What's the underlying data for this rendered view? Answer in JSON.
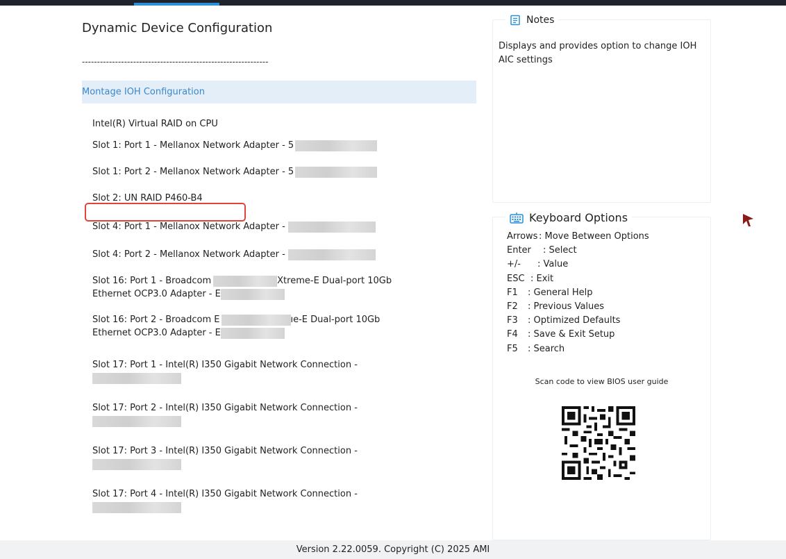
{
  "page": {
    "title": "Dynamic Device Configuration",
    "separator": "--------------------------------------------------------------"
  },
  "items": [
    {
      "lines": [
        "Montage IOH Configuration"
      ],
      "selected": true
    },
    {
      "lines": [
        "Intel(R) Virtual RAID on CPU"
      ]
    },
    {
      "lines": [
        "Slot 1: Port 1 - Mellanox Network Adapter - 5"
      ]
    },
    {
      "lines": [
        "Slot 1: Port 2 - Mellanox Network Adapter - 5"
      ]
    },
    {
      "lines": [
        "Slot 2: UN RAID P460-B4"
      ]
    },
    {
      "lines": [
        "Slot 4: Port 1 - Mellanox Network Adapter -"
      ]
    },
    {
      "lines": [
        "Slot 4: Port 2 - Mellanox Network Adapter -"
      ]
    },
    {
      "lines": [
        "Slot 16: Port 1 - Broadcom",
        "Ethernet OCP3.0 Adapter - E"
      ],
      "extra": "Xtreme-E Dual-port 10Gb"
    },
    {
      "lines": [
        "Slot 16: Port 2 - Broadcom E",
        "Ethernet OCP3.0 Adapter - E"
      ],
      "extra": "ıe-E Dual-port 10Gb"
    },
    {
      "lines": [
        "Slot 17: Port 1 - Intel(R) I350 Gigabit Network Connection -"
      ]
    },
    {
      "lines": [
        "Slot 17: Port 2 - Intel(R) I350 Gigabit Network Connection -"
      ]
    },
    {
      "lines": [
        "Slot 17: Port 3 - Intel(R) I350 Gigabit Network Connection -"
      ]
    },
    {
      "lines": [
        "Slot 17: Port 4 - Intel(R) I350 Gigabit Network Connection -"
      ]
    }
  ],
  "notes": {
    "title": "Notes",
    "text": "Displays and provides option to change IOH AIC settings"
  },
  "keyboard": {
    "title": "Keyboard Options",
    "options": [
      {
        "key": "Arrows",
        "desc": ": Move Between Options"
      },
      {
        "key": "Enter",
        "desc": ": Select"
      },
      {
        "key": "+/-",
        "desc": ": Value"
      },
      {
        "key": "ESC",
        "desc": ": Exit"
      },
      {
        "key": "F1",
        "desc": ": General Help"
      },
      {
        "key": "F2",
        "desc": ": Previous Values"
      },
      {
        "key": "F3",
        "desc": ": Optimized Defaults"
      },
      {
        "key": "F4",
        "desc": ": Save & Exit Setup"
      },
      {
        "key": "F5",
        "desc": ": Search"
      }
    ],
    "qr_caption": "Scan code to view BIOS user guide"
  },
  "footer": {
    "version": "Version 2.22.0059. Copyright (C) 2025 AMI"
  },
  "colors": {
    "accent": "#2d8fd5",
    "selected_bg": "#e3eef9",
    "selected_text": "#3b88c9",
    "highlight_box": "#e0433a",
    "cursor": "#8b1a1a",
    "topbar": "#1f232b"
  }
}
